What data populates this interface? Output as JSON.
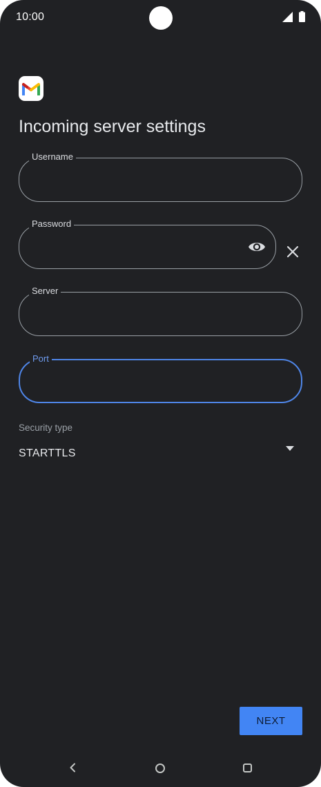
{
  "status_bar": {
    "time": "10:00",
    "icons": [
      "signal-icon",
      "battery-icon"
    ]
  },
  "app": {
    "logo": "gmail-logo",
    "title": "Incoming server settings"
  },
  "form": {
    "username": {
      "label": "Username",
      "value": ""
    },
    "password": {
      "label": "Password",
      "value": "",
      "toggle_icon": "eye-icon",
      "clear_icon": "close-icon"
    },
    "server": {
      "label": "Server",
      "value": ""
    },
    "port": {
      "label": "Port",
      "value": "",
      "focused": true
    },
    "security_type": {
      "label": "Security type",
      "value": "STARTTLS",
      "dropdown_icon": "arrow-drop-down-icon"
    }
  },
  "actions": {
    "next_label": "NEXT"
  },
  "nav_bar": {
    "icons": [
      "back-icon",
      "home-icon",
      "recents-icon"
    ]
  },
  "colors": {
    "background": "#202124",
    "accent": "#4285f4",
    "focus_border": "#4f86e8",
    "outline": "#9aa0a6"
  }
}
